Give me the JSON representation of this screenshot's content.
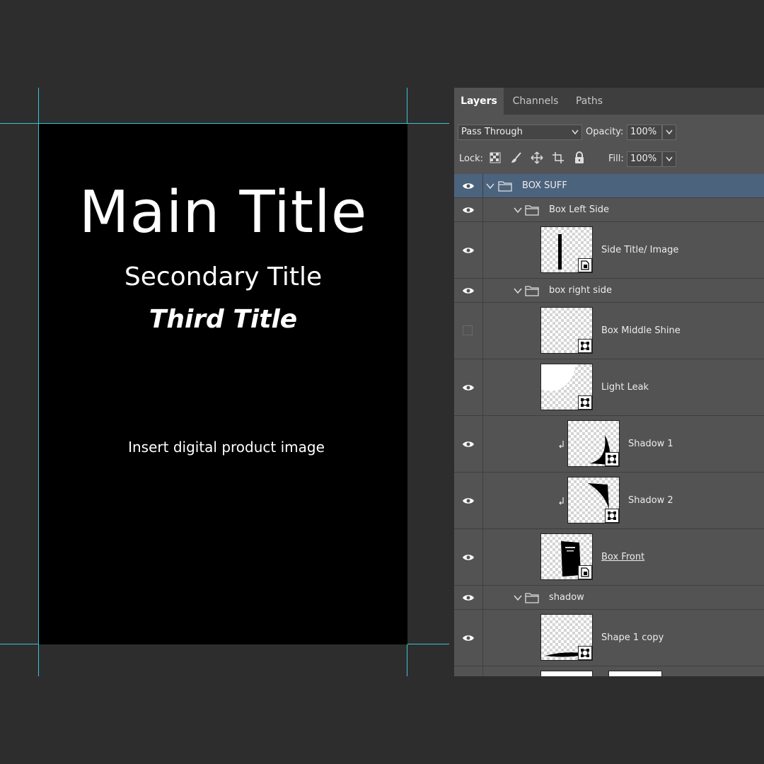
{
  "canvas": {
    "main_title": "Main Title",
    "secondary_title": "Secondary Title",
    "third_title": "Third Title",
    "placeholder_text": "Insert digital product image"
  },
  "colors": {
    "background": "#2d2d2d",
    "guide": "#34c7d6",
    "document": "#000000",
    "panel": "#535353",
    "selected_row": "#4c637d"
  },
  "panel": {
    "tabs": [
      {
        "label": "Layers",
        "active": true
      },
      {
        "label": "Channels",
        "active": false
      },
      {
        "label": "Paths",
        "active": false
      }
    ],
    "blend_mode": "Pass Through",
    "opacity_label": "Opacity:",
    "opacity_value": "100%",
    "lock_label": "Lock:",
    "fill_label": "Fill:",
    "fill_value": "100%",
    "lock_icons": [
      "transparency-lock-icon",
      "brush-icon",
      "move-icon",
      "artboard-icon",
      "padlock-icon"
    ]
  },
  "layers": [
    {
      "name": "BOX SUFF",
      "kind": "group",
      "visible": true,
      "selected": true
    },
    {
      "name": "Box Left Side",
      "kind": "group",
      "visible": true
    },
    {
      "name": "Side Title/ Image",
      "kind": "smart-object",
      "visible": true
    },
    {
      "name": "box right side",
      "kind": "group",
      "visible": true
    },
    {
      "name": "Box Middle Shine",
      "kind": "shape",
      "visible": false
    },
    {
      "name": "Light Leak",
      "kind": "shape",
      "visible": true
    },
    {
      "name": "Shadow 1",
      "kind": "shape",
      "visible": true,
      "clipped": true
    },
    {
      "name": "Shadow 2",
      "kind": "shape",
      "visible": true,
      "clipped": true
    },
    {
      "name": "Box Front",
      "kind": "smart-object",
      "visible": true
    },
    {
      "name": "shadow",
      "kind": "group",
      "visible": true
    },
    {
      "name": "Shape 1 copy",
      "kind": "shape",
      "visible": true
    }
  ]
}
